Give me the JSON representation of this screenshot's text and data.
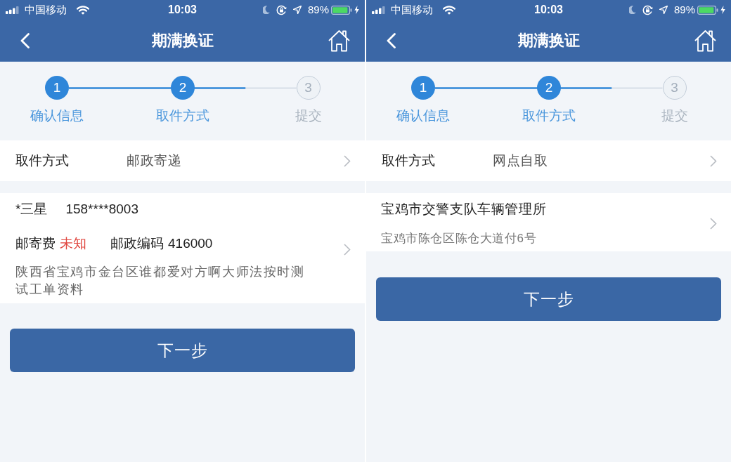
{
  "screens": [
    {
      "status_bar": {
        "carrier": "中国移动",
        "time": "10:03",
        "battery": "89%"
      },
      "title": "期满换证",
      "steps": [
        {
          "number": "1",
          "label": "确认信息",
          "active": true
        },
        {
          "number": "2",
          "label": "取件方式",
          "active": true
        },
        {
          "number": "3",
          "label": "提交",
          "active": false
        }
      ],
      "pickup": {
        "label": "取件方式",
        "value": "邮政寄递"
      },
      "detail": {
        "kind": "mail",
        "name": "*三星",
        "phone": "158****8003",
        "fee_label": "邮寄费",
        "fee_value": "未知",
        "postcode_label": "邮政编码",
        "postcode": "416000",
        "address": "陕西省宝鸡市金台区谁都爱对方啊大师法按时测试工单资料"
      },
      "button": "下一步"
    },
    {
      "status_bar": {
        "carrier": "中国移动",
        "time": "10:03",
        "battery": "89%"
      },
      "title": "期满换证",
      "steps": [
        {
          "number": "1",
          "label": "确认信息",
          "active": true
        },
        {
          "number": "2",
          "label": "取件方式",
          "active": true
        },
        {
          "number": "3",
          "label": "提交",
          "active": false
        }
      ],
      "pickup": {
        "label": "取件方式",
        "value": "网点自取"
      },
      "detail": {
        "kind": "branch",
        "name": "宝鸡市交警支队车辆管理所",
        "address": "宝鸡市陈仓区陈仓大道付6号"
      },
      "button": "下一步"
    }
  ]
}
